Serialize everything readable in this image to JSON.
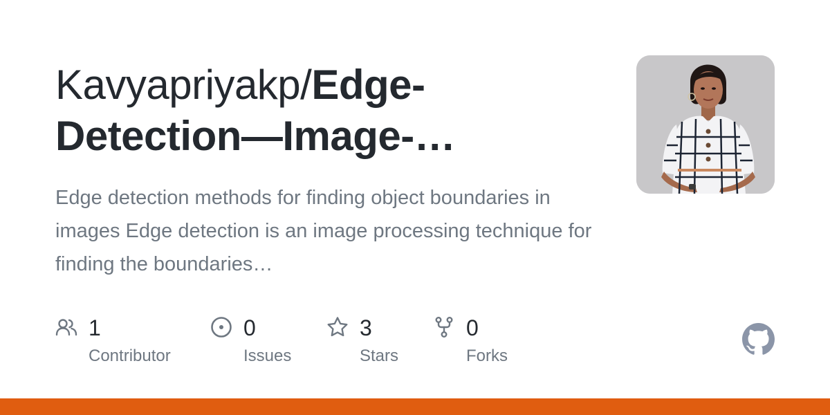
{
  "repo": {
    "owner": "Kavyapriyakp/",
    "name": "Edge-Detection—Image-…",
    "description": "Edge detection methods for finding object boundaries in images Edge detection is an image processing technique for finding the boundaries…"
  },
  "avatar": {
    "alt": "avatar"
  },
  "stats": {
    "contributors": {
      "count": "1",
      "label": "Contributor",
      "icon": "people-icon"
    },
    "issues": {
      "count": "0",
      "label": "Issues",
      "icon": "issue-opened-icon"
    },
    "stars": {
      "count": "3",
      "label": "Stars",
      "icon": "star-icon"
    },
    "forks": {
      "count": "0",
      "label": "Forks",
      "icon": "repo-forked-icon"
    }
  },
  "colors": {
    "title": "#24292f",
    "muted": "#6e7781",
    "icon": "#6e7781",
    "logo": "#8b95a8",
    "language_bar": "#e05d10"
  }
}
